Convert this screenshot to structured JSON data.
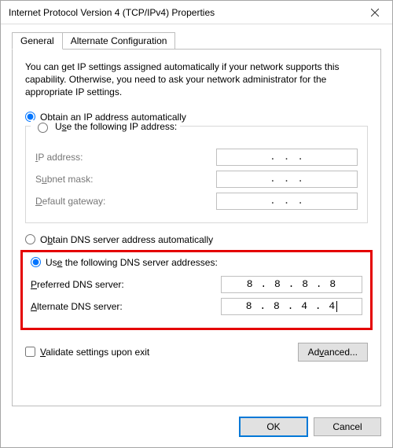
{
  "window": {
    "title": "Internet Protocol Version 4 (TCP/IPv4) Properties"
  },
  "tabs": {
    "general": "General",
    "alt": "Alternate Configuration"
  },
  "description": "You can get IP settings assigned automatically if your network supports this capability. Otherwise, you need to ask your network administrator for the appropriate IP settings.",
  "ip_section": {
    "auto_label_pre": "O",
    "auto_label_rest": "btain an IP address automatically",
    "manual_label_pre": "U",
    "manual_label_post_s": "s",
    "manual_label_rest": "e the following IP address:",
    "ip_label_pre": "I",
    "ip_label_rest": "P address:",
    "subnet_label_pre": "S",
    "subnet_label_u": "u",
    "subnet_label_rest": "bnet mask:",
    "gateway_label_pre": "D",
    "gateway_label_rest": "efault gateway:",
    "dots": ".       .       ."
  },
  "dns_section": {
    "auto_label_pre": "O",
    "auto_label_u": "b",
    "auto_label_rest": "tain DNS server address automatically",
    "manual_label_pre": "Us",
    "manual_label_u": "e",
    "manual_label_rest": " the following DNS server addresses:",
    "preferred_label_pre": "P",
    "preferred_label_rest": "referred DNS server:",
    "alternate_label_pre": "A",
    "alternate_label_rest": "lternate DNS server:",
    "preferred_value": "8 . 8 . 8 . 8",
    "alternate_value": "8 . 8 . 4 . 4"
  },
  "validate_label_pre": "V",
  "validate_label_rest": "alidate settings upon exit",
  "validate_u": "V",
  "advanced_pre": "Ad",
  "advanced_u": "v",
  "advanced_rest": "anced...",
  "buttons": {
    "ok": "OK",
    "cancel": "Cancel"
  }
}
